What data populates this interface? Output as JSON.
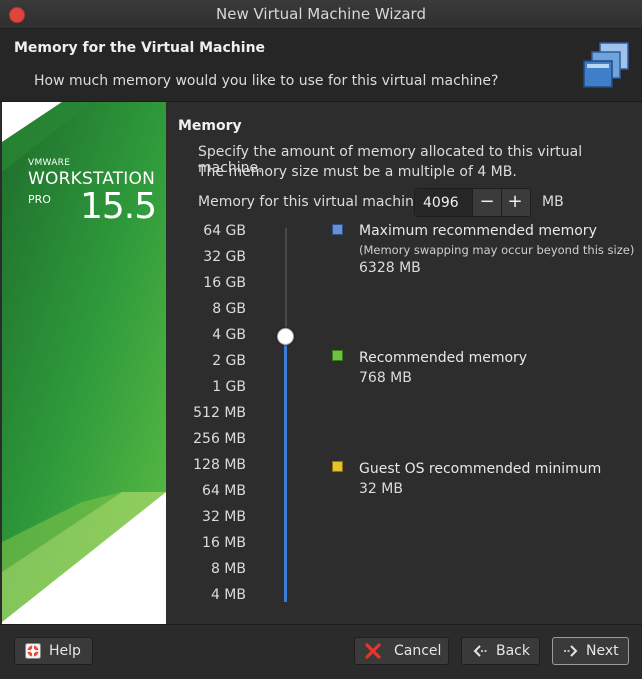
{
  "window": {
    "title": "New Virtual Machine Wizard"
  },
  "header": {
    "title": "Memory for the Virtual Machine",
    "subtitle": "How much memory would you like to use for this virtual machine?"
  },
  "banner": {
    "brand": "VMWARE",
    "product": "WORKSTATION",
    "edition": "PRO",
    "version": "15.5"
  },
  "memory": {
    "section_title": "Memory",
    "description_line1": "Specify the amount of memory allocated to this virtual machine.",
    "description_line2": "The memory size must be a multiple of 4 MB.",
    "field_label": "Memory for this virtual machine:",
    "value": "4096",
    "unit": "MB",
    "decrement_label": "−",
    "increment_label": "+"
  },
  "slider": {
    "labels": [
      "64 GB",
      "32 GB",
      "16 GB",
      "8 GB",
      "4 GB",
      "2 GB",
      "1 GB",
      "512 MB",
      "256 MB",
      "128 MB",
      "64 MB",
      "32 MB",
      "16 MB",
      "8 MB",
      "4 MB"
    ],
    "selected_label": "4 GB"
  },
  "legend": {
    "max": {
      "title": "Maximum recommended memory",
      "note": "(Memory swapping may occur beyond this size)",
      "value": "6328 MB",
      "color": "#6b8fd0"
    },
    "recommended": {
      "title": "Recommended memory",
      "value": "768 MB",
      "color": "#6fc23d"
    },
    "minimum": {
      "title": "Guest OS recommended minimum",
      "value": "32 MB",
      "color": "#e6c229"
    }
  },
  "footer": {
    "help": "Help",
    "cancel": "Cancel",
    "back": "Back",
    "next": "Next"
  },
  "icons": {
    "close": "close-icon",
    "vm": "virtual-machine-icon",
    "help": "help-icon",
    "cancel": "cancel-x-icon",
    "back": "back-arrow-icon",
    "next": "next-arrow-icon"
  }
}
